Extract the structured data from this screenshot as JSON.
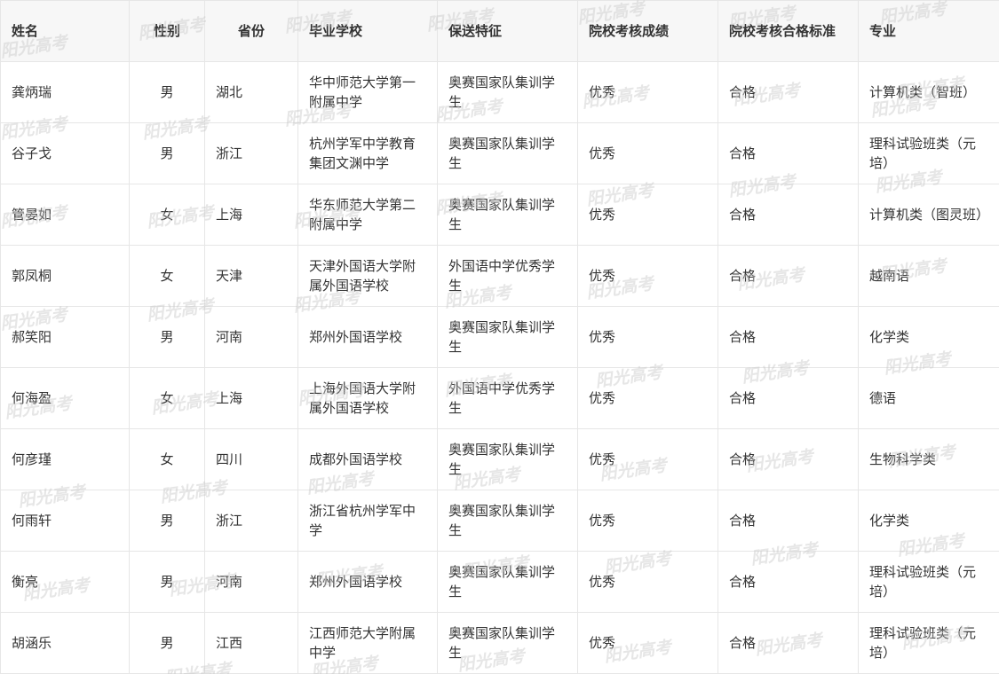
{
  "headers": [
    "姓名",
    "性别",
    "省份",
    "毕业学校",
    "保送特征",
    "院校考核成绩",
    "院校考核合格标准",
    "专业"
  ],
  "rows": [
    [
      "龚炳瑞",
      "男",
      "湖北",
      "华中师范大学第一附属中学",
      "奥赛国家队集训学生",
      "优秀",
      "合格",
      "计算机类（智班）"
    ],
    [
      "谷子戈",
      "男",
      "浙江",
      "杭州学军中学教育集团文渊中学",
      "奥赛国家队集训学生",
      "优秀",
      "合格",
      "理科试验班类（元培）"
    ],
    [
      "管晏如",
      "女",
      "上海",
      "华东师范大学第二附属中学",
      "奥赛国家队集训学生",
      "优秀",
      "合格",
      "计算机类（图灵班）"
    ],
    [
      "郭凤桐",
      "女",
      "天津",
      "天津外国语大学附属外国语学校",
      "外国语中学优秀学生",
      "优秀",
      "合格",
      "越南语"
    ],
    [
      "郝笑阳",
      "男",
      "河南",
      "郑州外国语学校",
      "奥赛国家队集训学生",
      "优秀",
      "合格",
      "化学类"
    ],
    [
      "何海盈",
      "女",
      "上海",
      "上海外国语大学附属外国语学校",
      "外国语中学优秀学生",
      "优秀",
      "合格",
      "德语"
    ],
    [
      "何彦瑾",
      "女",
      "四川",
      "成都外国语学校",
      "奥赛国家队集训学生",
      "优秀",
      "合格",
      "生物科学类"
    ],
    [
      "何雨轩",
      "男",
      "浙江",
      "浙江省杭州学军中学",
      "奥赛国家队集训学生",
      "优秀",
      "合格",
      "化学类"
    ],
    [
      "衡亮",
      "男",
      "河南",
      "郑州外国语学校",
      "奥赛国家队集训学生",
      "优秀",
      "合格",
      "理科试验班类（元培）"
    ],
    [
      "胡涵乐",
      "男",
      "江西",
      "江西师范大学附属中学",
      "奥赛国家队集训学生",
      "优秀",
      "合格",
      "理科试验班类（元培）"
    ]
  ],
  "watermark_text": "阳光高考"
}
